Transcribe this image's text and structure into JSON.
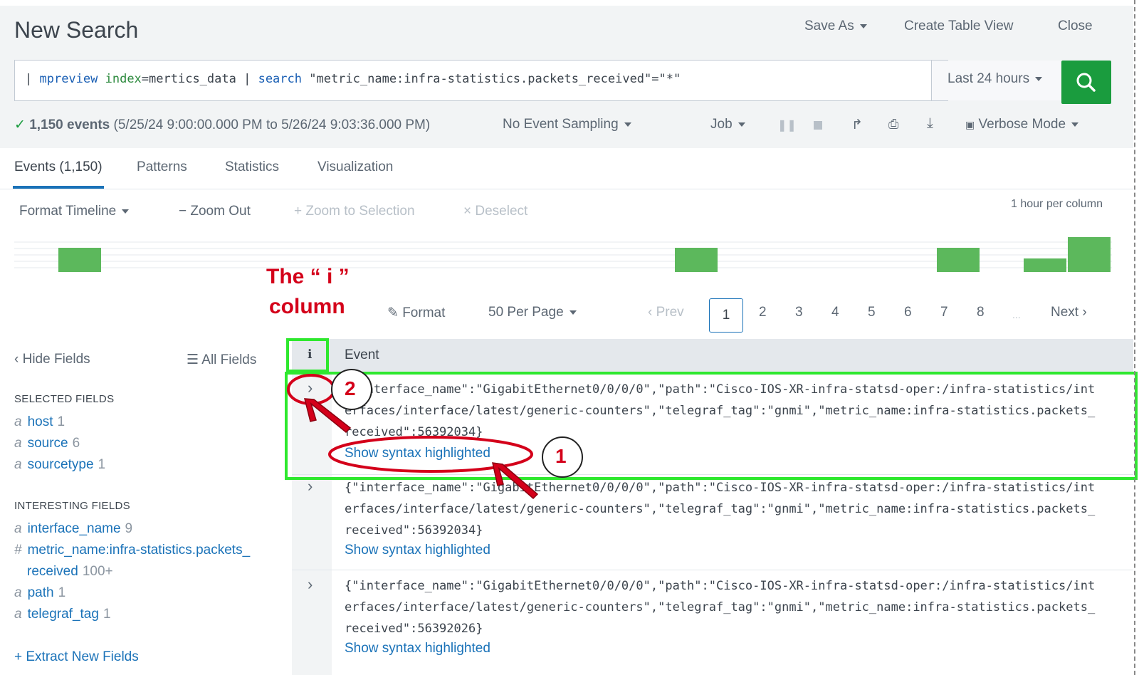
{
  "header": {
    "title": "New Search",
    "save_as": "Save As",
    "create_table_view": "Create Table View",
    "close": "Close"
  },
  "search": {
    "query_pipe1": "| ",
    "query_cmd1": "mpreview",
    "query_index_key": " index",
    "query_index_val": "=mertics_data",
    "query_pipe2": " | ",
    "query_cmd2": "search",
    "query_rest": " \"metric_name:infra-statistics.packets_received\"=\"*\"",
    "time_range": "Last 24 hours"
  },
  "status": {
    "events": "1,150 events",
    "range": "(5/25/24 9:00:00.000 PM to 5/26/24 9:03:36.000 PM)",
    "sampling": "No Event Sampling",
    "job": "Job",
    "mode": "Verbose Mode"
  },
  "tabs": {
    "events": "Events (1,150)",
    "patterns": "Patterns",
    "statistics": "Statistics",
    "visualization": "Visualization"
  },
  "timeline": {
    "format": "Format Timeline",
    "zoom_out": "− Zoom Out",
    "zoom_selection": "+ Zoom to Selection",
    "deselect": "× Deselect",
    "scale": "1 hour per column"
  },
  "pagination": {
    "format": "Format",
    "per_page": "50 Per Page",
    "prev": "‹ Prev",
    "pages": [
      "1",
      "2",
      "3",
      "4",
      "5",
      "6",
      "7",
      "8"
    ],
    "ellipsis": "...",
    "next": "Next ›"
  },
  "sidebar": {
    "hide_fields": "‹ Hide Fields",
    "all_fields": "All Fields",
    "selected_heading": "SELECTED FIELDS",
    "selected": [
      {
        "type": "a",
        "name": "host",
        "count": "1"
      },
      {
        "type": "a",
        "name": "source",
        "count": "6"
      },
      {
        "type": "a",
        "name": "sourcetype",
        "count": "1"
      }
    ],
    "interesting_heading": "INTERESTING FIELDS",
    "interesting": [
      {
        "type": "a",
        "name": "interface_name",
        "count": "9"
      },
      {
        "type": "#",
        "name": "metric_name:infra-statistics.packets_",
        "name2": "received",
        "count": "100+"
      },
      {
        "type": "a",
        "name": "path",
        "count": "1"
      },
      {
        "type": "a",
        "name": "telegraf_tag",
        "count": "1"
      }
    ],
    "extract": "+ Extract New Fields"
  },
  "table": {
    "i_header": "i",
    "event_header": "Event",
    "rows": [
      {
        "line1": "{\"interface_name\":\"GigabitEthernet0/0/0/0\",\"path\":\"Cisco-IOS-XR-infra-statsd-oper:/infra-statistics/int",
        "line2": "erfaces/interface/latest/generic-counters\",\"telegraf_tag\":\"gnmi\",\"metric_name:infra-statistics.packets_",
        "line3": "received\":56392034}",
        "show": "Show syntax highlighted"
      },
      {
        "line1": "{\"interface_name\":\"GigabitEthernet0/0/0/0\",\"path\":\"Cisco-IOS-XR-infra-statsd-oper:/infra-statistics/int",
        "line2": "erfaces/interface/latest/generic-counters\",\"telegraf_tag\":\"gnmi\",\"metric_name:infra-statistics.packets_",
        "line3": "received\":56392034}",
        "show": "Show syntax highlighted"
      },
      {
        "line1": "{\"interface_name\":\"GigabitEthernet0/0/0/0\",\"path\":\"Cisco-IOS-XR-infra-statsd-oper:/infra-statistics/int",
        "line2": "erfaces/interface/latest/generic-counters\",\"telegraf_tag\":\"gnmi\",\"metric_name:infra-statistics.packets_",
        "line3": "received\":56392026}",
        "show": "Show syntax highlighted"
      }
    ]
  },
  "annotations": {
    "i_column_line1": "The “ i ”",
    "i_column_line2": "column",
    "marker_1": "1",
    "marker_2": "2",
    "highlight_color": "#2ee82e",
    "marker_color": "#d4001a"
  },
  "colors": {
    "accent_green": "#1a9c3e",
    "link_blue": "#1a72b8",
    "timeline_green": "#5cb85c"
  }
}
